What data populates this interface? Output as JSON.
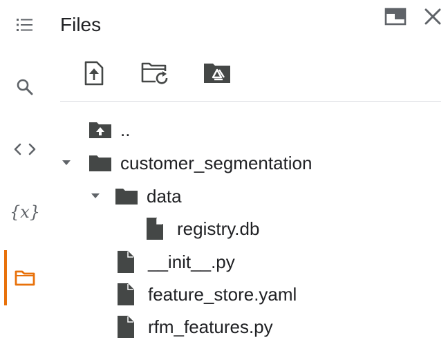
{
  "sidebar": {
    "items": [
      {
        "name": "table-of-contents",
        "icon": "list-icon"
      },
      {
        "name": "find",
        "icon": "search-icon"
      },
      {
        "name": "code-snippets",
        "icon": "code-icon"
      },
      {
        "name": "variables",
        "icon": "variables-icon",
        "label": "{x}"
      },
      {
        "name": "files",
        "icon": "folder-icon",
        "active": true
      }
    ],
    "active_color": "#e8710a"
  },
  "panel": {
    "title": "Files",
    "header_icons": [
      "new-window-icon",
      "close-icon"
    ],
    "toolbar": [
      "upload-file-icon",
      "refresh-folder-icon",
      "mount-drive-icon"
    ]
  },
  "tree": {
    "parent_label": "..",
    "items": [
      {
        "label": "customer_segmentation",
        "type": "folder",
        "expanded": true,
        "depth": 0
      },
      {
        "label": "data",
        "type": "folder",
        "expanded": true,
        "depth": 1
      },
      {
        "label": "registry.db",
        "type": "file",
        "depth": 2
      },
      {
        "label": "__init__.py",
        "type": "file",
        "depth": 1
      },
      {
        "label": "feature_store.yaml",
        "type": "file",
        "depth": 1
      },
      {
        "label": "rfm_features.py",
        "type": "file",
        "depth": 1
      }
    ]
  },
  "colors": {
    "icon": "#5f6368",
    "folder": "#444746",
    "text": "#202124",
    "divider": "#dadce0"
  }
}
